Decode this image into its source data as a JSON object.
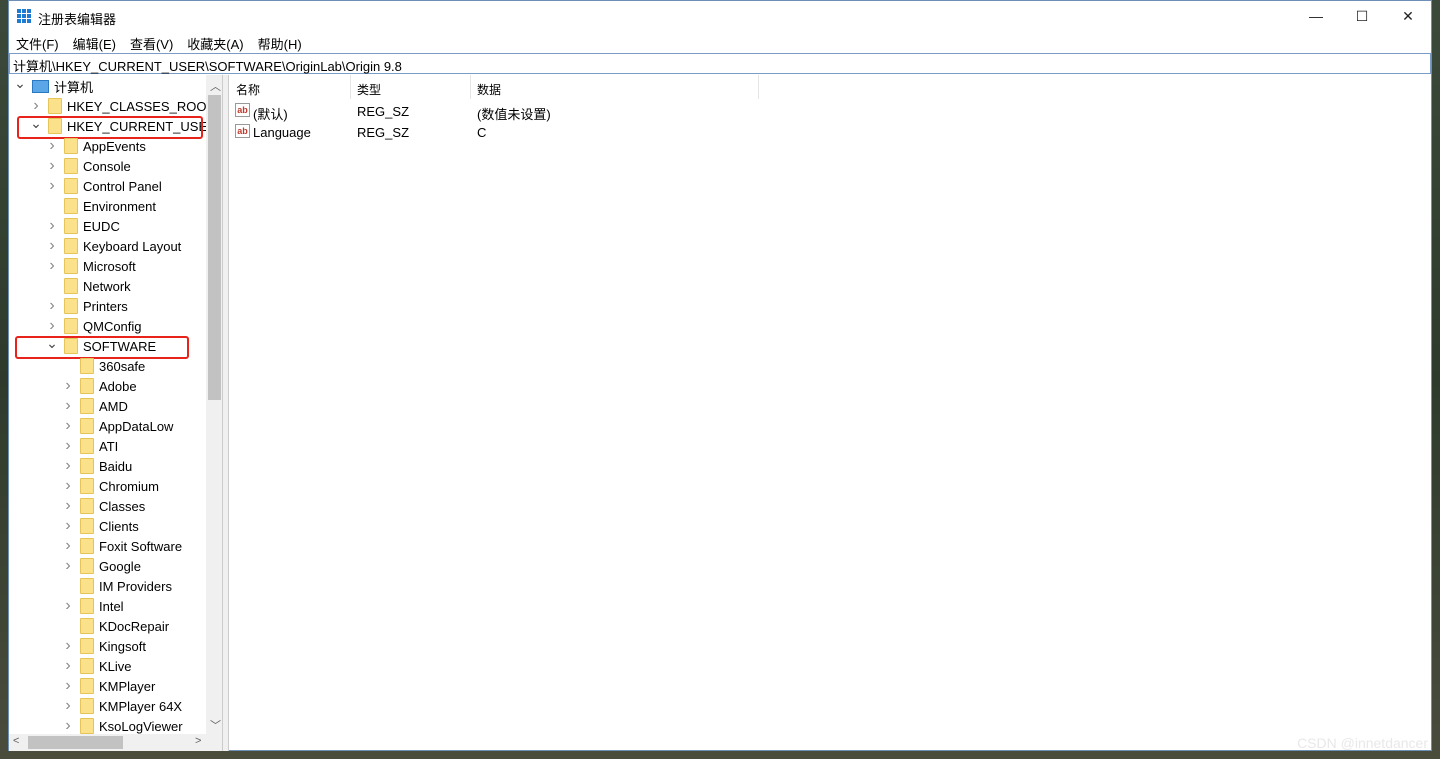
{
  "window": {
    "title": "注册表编辑器",
    "minimize": "—",
    "maximize": "☐",
    "close": "✕"
  },
  "menu": [
    "文件(F)",
    "编辑(E)",
    "查看(V)",
    "收藏夹(A)",
    "帮助(H)"
  ],
  "address": "计算机\\HKEY_CURRENT_USER\\SOFTWARE\\OriginLab\\Origin 9.8",
  "tree": [
    {
      "label": "计算机",
      "level": 0,
      "state": "open",
      "icon": "computer-icon"
    },
    {
      "label": "HKEY_CLASSES_ROOT",
      "level": 1,
      "state": "closed"
    },
    {
      "label": "HKEY_CURRENT_USER",
      "level": 1,
      "state": "open",
      "highlight": true
    },
    {
      "label": "AppEvents",
      "level": 2,
      "state": "closed"
    },
    {
      "label": "Console",
      "level": 2,
      "state": "closed"
    },
    {
      "label": "Control Panel",
      "level": 2,
      "state": "closed"
    },
    {
      "label": "Environment",
      "level": 2,
      "state": "none"
    },
    {
      "label": "EUDC",
      "level": 2,
      "state": "closed"
    },
    {
      "label": "Keyboard Layout",
      "level": 2,
      "state": "closed"
    },
    {
      "label": "Microsoft",
      "level": 2,
      "state": "closed"
    },
    {
      "label": "Network",
      "level": 2,
      "state": "none"
    },
    {
      "label": "Printers",
      "level": 2,
      "state": "closed"
    },
    {
      "label": "QMConfig",
      "level": 2,
      "state": "closed"
    },
    {
      "label": "SOFTWARE",
      "level": 2,
      "state": "open",
      "highlight": true
    },
    {
      "label": "360safe",
      "level": 3,
      "state": "none"
    },
    {
      "label": "Adobe",
      "level": 3,
      "state": "closed"
    },
    {
      "label": "AMD",
      "level": 3,
      "state": "closed"
    },
    {
      "label": "AppDataLow",
      "level": 3,
      "state": "closed"
    },
    {
      "label": "ATI",
      "level": 3,
      "state": "closed"
    },
    {
      "label": "Baidu",
      "level": 3,
      "state": "closed"
    },
    {
      "label": "Chromium",
      "level": 3,
      "state": "closed"
    },
    {
      "label": "Classes",
      "level": 3,
      "state": "closed"
    },
    {
      "label": "Clients",
      "level": 3,
      "state": "closed"
    },
    {
      "label": "Foxit Software",
      "level": 3,
      "state": "closed"
    },
    {
      "label": "Google",
      "level": 3,
      "state": "closed"
    },
    {
      "label": "IM Providers",
      "level": 3,
      "state": "none"
    },
    {
      "label": "Intel",
      "level": 3,
      "state": "closed"
    },
    {
      "label": "KDocRepair",
      "level": 3,
      "state": "none"
    },
    {
      "label": "Kingsoft",
      "level": 3,
      "state": "closed"
    },
    {
      "label": "KLive",
      "level": 3,
      "state": "closed"
    },
    {
      "label": "KMPlayer",
      "level": 3,
      "state": "closed"
    },
    {
      "label": "KMPlayer 64X",
      "level": 3,
      "state": "closed"
    },
    {
      "label": "KsoLogViewer",
      "level": 3,
      "state": "closed"
    }
  ],
  "columns": [
    "名称",
    "类型",
    "数据"
  ],
  "values": [
    {
      "name": "(默认)",
      "type": "REG_SZ",
      "data": "(数值未设置)",
      "icon": "ab"
    },
    {
      "name": "Language",
      "type": "REG_SZ",
      "data": "C",
      "icon": "ab"
    }
  ],
  "highlight_color": "#e8231c",
  "watermark": "CSDN @innetdancer"
}
